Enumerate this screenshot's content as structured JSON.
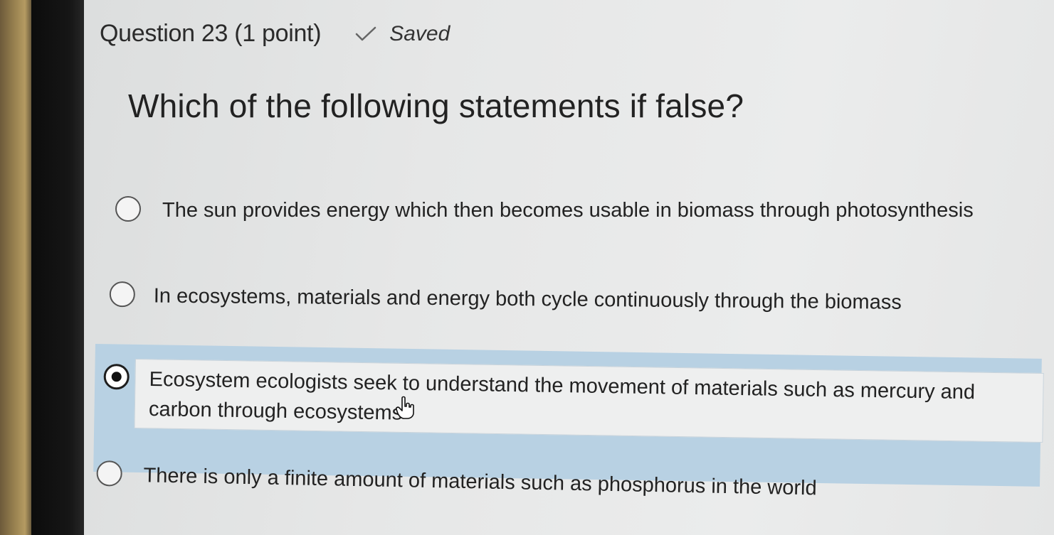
{
  "question": {
    "title": "Question 23 (1 point)",
    "status": "Saved",
    "status_icon": "checkmark-icon",
    "prompt": "Which of the following statements if false?"
  },
  "options": [
    {
      "label": "The sun provides energy which then becomes usable in biomass through photosynthesis",
      "selected": false
    },
    {
      "label": "In ecosystems, materials and energy both cycle continuously through the biomass",
      "selected": false
    },
    {
      "label_line1": "Ecosystem ecologists seek to understand the movement of materials such as mercury and",
      "label_line2": "carbon through ecosystems",
      "selected": true
    },
    {
      "label": "There is only a finite amount of materials such as phosphorus in the world",
      "selected": false
    }
  ],
  "colors": {
    "selected_highlight": "#b8d1e3",
    "text": "#222222"
  },
  "cursor": "hand-pointer-icon"
}
